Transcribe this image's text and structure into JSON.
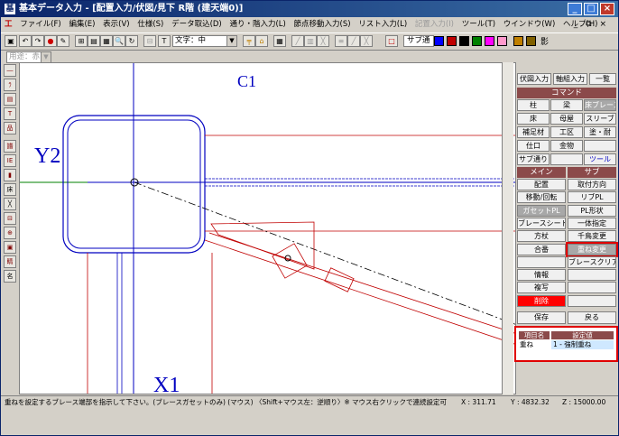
{
  "title": "基本データ入力 - [配置入力/伏図/見下 R階 (建天端0)]",
  "menus": [
    "ファイル(F)",
    "編集(E)",
    "表示(V)",
    "仕様(S)",
    "データ取込(D)",
    "通り・階入力(L)",
    "節点移動入力(S)",
    "リスト入力(L)",
    "記置入力(I)",
    "ツール(T)",
    "ウインドウ(W)",
    "ヘルプ(H)"
  ],
  "toolbar": {
    "text_label": "文字：中",
    "sub_label": "サブ通",
    "shadow_label": "影",
    "scale_label": "用途：赤"
  },
  "colors": {
    "swatches": [
      "#0000ff",
      "#c00000",
      "#c00000",
      "#000000",
      "#008000",
      "#ff00ff",
      "#ff99cc",
      "#c08000",
      "#806000"
    ],
    "highlight": "#e00000",
    "panel_header": "#8b4a4a"
  },
  "canvas": {
    "label_c1": "C1",
    "label_y2": "Y2",
    "label_x1": "X1"
  },
  "panel": {
    "top_tabs": [
      "伏図入力",
      "軸組入力",
      "一覧"
    ],
    "command_header": "コマンド",
    "commands": [
      [
        "柱",
        "梁",
        "床ブレース"
      ],
      [
        "床",
        "母屋",
        "スリーブ"
      ],
      [
        "補足材",
        "工区",
        "塗・耐"
      ],
      [
        "仕口",
        "金物",
        ""
      ],
      [
        "サブ通り",
        "",
        "ツール"
      ]
    ],
    "main_header": "メイン",
    "sub_header": "サブ",
    "main_items": [
      "配置",
      "移動/回転",
      "ガセットPL",
      "ブレースシート",
      "方杖",
      "合番",
      "",
      "情報",
      "複写",
      "削除"
    ],
    "sub_items": [
      "取付方向",
      "リブPL",
      "PL形状",
      "一体指定",
      "千鳥変更",
      "重ね変更",
      "ブレースクリア",
      "",
      "",
      ""
    ],
    "save": "保存",
    "back": "戻る",
    "prop_headers": [
      "項目名",
      "設定値"
    ],
    "prop_name": "重ね",
    "prop_value": "1 - 強制重ね"
  },
  "status": {
    "message": "重ねを設定するブレース端部を指示して下さい。(ブレースガセットのみ) (マウス) 〈Shift+マウス左：逆順り〉※ マウス右クリックで連続設定可",
    "x": "X : 311.71",
    "y": "Y : 4832.32",
    "z": "Z : 15000.00"
  }
}
